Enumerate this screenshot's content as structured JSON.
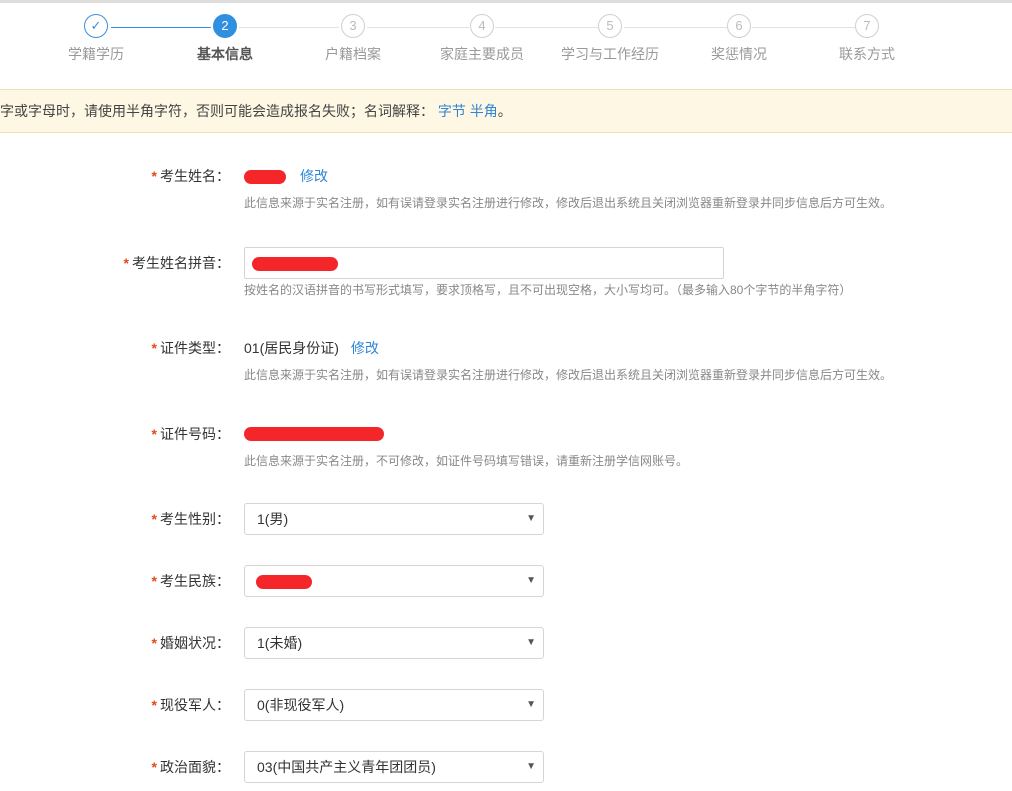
{
  "steps": [
    {
      "number": "✓",
      "label": "学籍学历"
    },
    {
      "number": "2",
      "label": "基本信息"
    },
    {
      "number": "3",
      "label": "户籍档案"
    },
    {
      "number": "4",
      "label": "家庭主要成员"
    },
    {
      "number": "5",
      "label": "学习与工作经历"
    },
    {
      "number": "6",
      "label": "奖惩情况"
    },
    {
      "number": "7",
      "label": "联系方式"
    }
  ],
  "notice": {
    "text": "字或字母时，请使用半角字符，否则可能会造成报名失败；名词解释：",
    "link1": "字节",
    "link2": "半角",
    "tail": "。"
  },
  "form": {
    "required_mark": "*",
    "edit_label": "修改",
    "name": {
      "label": "考生姓名：",
      "hint": "此信息来源于实名注册，如有误请登录实名注册进行修改，修改后退出系统且关闭浏览器重新登录并同步信息后方可生效。"
    },
    "pinyin": {
      "label": "考生姓名拼音：",
      "hint": "按姓名的汉语拼音的书写形式填写，要求顶格写，且不可出现空格，大小写均可。（最多输入80个字节的半角字符）"
    },
    "id_type": {
      "label": "证件类型：",
      "value": "01(居民身份证)",
      "hint": "此信息来源于实名注册，如有误请登录实名注册进行修改，修改后退出系统且关闭浏览器重新登录并同步信息后方可生效。"
    },
    "id_number": {
      "label": "证件号码：",
      "hint": "此信息来源于实名注册，不可修改，如证件号码填写错误，请重新注册学信网账号。"
    },
    "gender": {
      "label": "考生性别：",
      "value": "1(男)"
    },
    "ethnicity": {
      "label": "考生民族：",
      "value": ""
    },
    "marital": {
      "label": "婚姻状况：",
      "value": "1(未婚)"
    },
    "military": {
      "label": "现役军人：",
      "value": "0(非现役军人)"
    },
    "political": {
      "label": "政治面貌：",
      "value": "03(中国共产主义青年团团员)"
    }
  },
  "colors": {
    "accent": "#2f8fe0",
    "required": "#e24a1b",
    "notice_bg": "#fdf7e3",
    "redaction": "#f5262a"
  },
  "icons": {
    "dropdown": "chevron-down-icon",
    "done": "check-icon"
  }
}
